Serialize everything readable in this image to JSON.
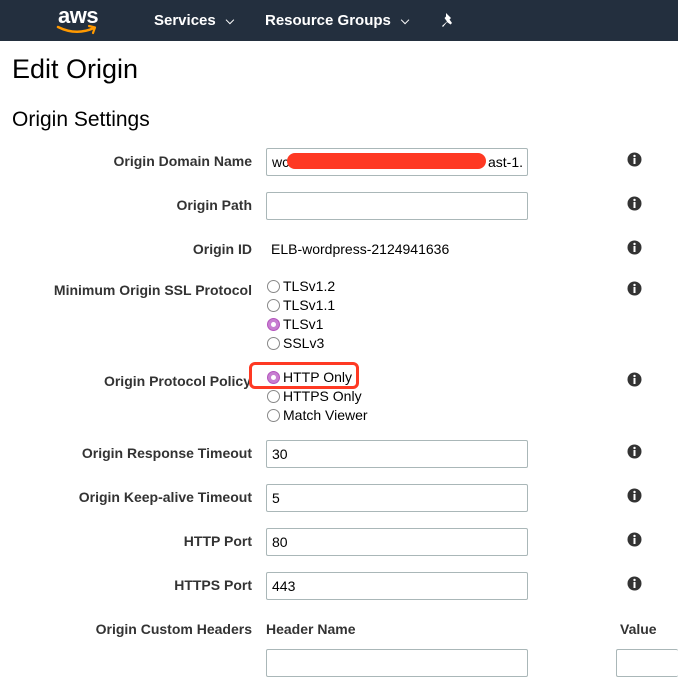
{
  "nav": {
    "logo_text": "aws",
    "services": "Services",
    "resource_groups": "Resource Groups"
  },
  "page_title": "Edit Origin",
  "section_title": "Origin Settings",
  "fields": {
    "origin_domain_name": {
      "label": "Origin Domain Name",
      "value_start": "wc",
      "value_end": "ast-1."
    },
    "origin_path": {
      "label": "Origin Path",
      "value": ""
    },
    "origin_id": {
      "label": "Origin ID",
      "value": "ELB-wordpress-2124941636"
    },
    "min_ssl_protocol": {
      "label": "Minimum Origin SSL Protocol",
      "options": [
        "TLSv1.2",
        "TLSv1.1",
        "TLSv1",
        "SSLv3"
      ],
      "selected": "TLSv1"
    },
    "origin_protocol_policy": {
      "label": "Origin Protocol Policy",
      "options": [
        "HTTP Only",
        "HTTPS Only",
        "Match Viewer"
      ],
      "selected": "HTTP Only"
    },
    "origin_response_timeout": {
      "label": "Origin Response Timeout",
      "value": "30"
    },
    "origin_keepalive_timeout": {
      "label": "Origin Keep-alive Timeout",
      "value": "5"
    },
    "http_port": {
      "label": "HTTP Port",
      "value": "80"
    },
    "https_port": {
      "label": "HTTPS Port",
      "value": "443"
    },
    "custom_headers": {
      "label": "Origin Custom Headers",
      "header_name_col": "Header Name",
      "value_col": "Value"
    }
  },
  "colors": {
    "navbar": "#232f3e",
    "highlight": "#fe3923",
    "radio_selected": "#c77ed1",
    "aws_smile": "#ff9900"
  }
}
